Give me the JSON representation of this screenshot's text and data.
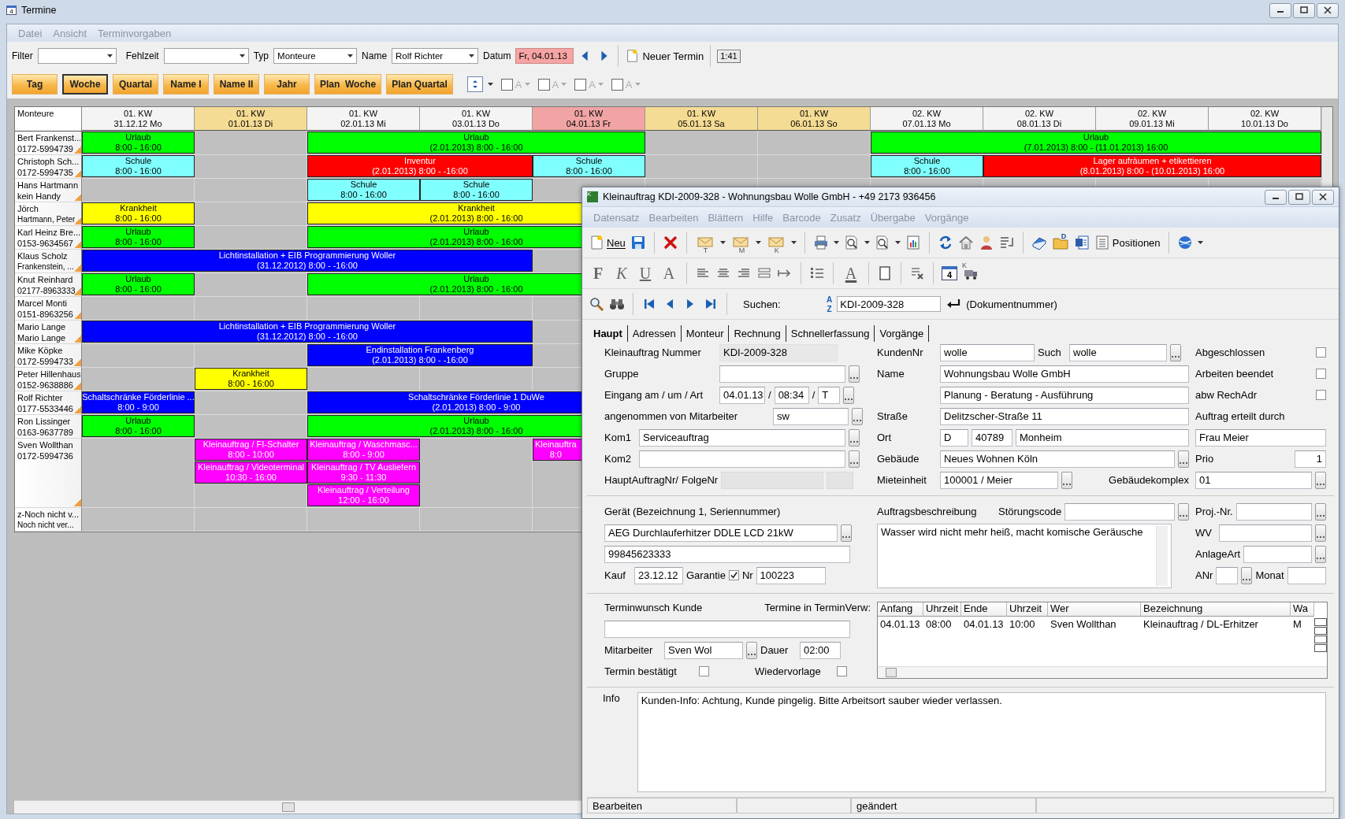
{
  "window": {
    "title": "Termine",
    "icon_label": "4"
  },
  "menu": [
    "Datei",
    "Ansicht",
    "Terminvorgaben"
  ],
  "filter_bar": {
    "fields": [
      {
        "label": "Filter"
      },
      {
        "label": "Fehlzeit"
      },
      {
        "label": "Typ",
        "value": "Monteure"
      },
      {
        "label": "Name",
        "value": "Rolf Richter"
      }
    ],
    "date_label": "Datum",
    "date_value": "Fr, 04.01.13",
    "new_button": "Neuer Termin",
    "clock": "1:41"
  },
  "view_buttons": [
    {
      "label": "Tag",
      "selected": false
    },
    {
      "label": "Woche",
      "selected": true
    },
    {
      "label": "Quartal",
      "selected": false
    },
    {
      "label": "Name I",
      "selected": false
    },
    {
      "label": "Name II",
      "selected": false
    },
    {
      "label": "Jahr",
      "selected": false
    },
    {
      "label": "Plan  Woche",
      "selected": false
    },
    {
      "label": "Plan Quartal",
      "selected": false
    }
  ],
  "color_filters": [
    {
      "label": "A",
      "checked": false
    },
    {
      "label": "A",
      "checked": false
    },
    {
      "label": "A",
      "checked": false
    },
    {
      "label": "A",
      "checked": false
    }
  ],
  "planner": {
    "corner": "Monteure",
    "columns": [
      {
        "week": "01. KW",
        "date": "31.12.12 Mo",
        "color": "#f4f4f4"
      },
      {
        "week": "01. KW",
        "date": "01.01.13 Di",
        "color": "#f5dc94"
      },
      {
        "week": "01. KW",
        "date": "02.01.13 Mi",
        "color": "#f4f4f4"
      },
      {
        "week": "01. KW",
        "date": "03.01.13 Do",
        "color": "#f4f4f4"
      },
      {
        "week": "01. KW",
        "date": "04.01.13 Fr",
        "color": "#f0a4a4"
      },
      {
        "week": "01. KW",
        "date": "05.01.13 Sa",
        "color": "#f5dc94"
      },
      {
        "week": "01. KW",
        "date": "06.01.13 So",
        "color": "#f5dc94"
      },
      {
        "week": "02. KW",
        "date": "07.01.13 Mo",
        "color": "#f4f4f4"
      },
      {
        "week": "02. KW",
        "date": "08.01.13 Di",
        "color": "#f4f4f4"
      },
      {
        "week": "02. KW",
        "date": "09.01.13 Mi",
        "color": "#f4f4f4"
      },
      {
        "week": "02. KW",
        "date": "10.01.13 Do",
        "color": "#f4f4f4"
      }
    ],
    "rows": [
      {
        "name": "Bert Frankenst...",
        "phone": "0172-5994739",
        "marked": true,
        "lanes": [
          [
            {
              "kind": "event",
              "title": "Urlaub",
              "time": "8:00 - 16:00",
              "color": "#00ff00",
              "cut": false
            },
            {
              "kind": "gap"
            },
            {
              "kind": "event",
              "title": "Urlaub",
              "time": "(2.01.2013) 8:00 - 16:00",
              "color": "#00ff00",
              "cut": false
            },
            {
              "kind": "more"
            },
            {
              "kind": "more"
            },
            {
              "kind": "gap"
            },
            {
              "kind": "gap"
            },
            {
              "kind": "event",
              "title": "Urlaub",
              "time": "(7.01.2013) 8:00 - (11.01.2013) 16:00",
              "color": "#00ff00",
              "cut": false
            },
            {
              "kind": "more"
            },
            {
              "kind": "more"
            },
            {
              "kind": "more"
            }
          ]
        ]
      },
      {
        "name": "Christoph Sch...",
        "phone": "0172-5994735",
        "marked": true,
        "lanes": [
          [
            {
              "kind": "event",
              "title": "Schule",
              "time": "8:00 - 16:00",
              "color": "#80ffff",
              "cut": false
            },
            {
              "kind": "gap"
            },
            {
              "kind": "event",
              "title": "Inventur",
              "time": "(2.01.2013) 8:00 - -16:00",
              "color": "#ff0000",
              "cut": false
            },
            {
              "kind": "more"
            },
            {
              "kind": "event",
              "title": "Schule",
              "time": "8:00 - 16:00",
              "color": "#80ffff",
              "cut": false
            },
            {
              "kind": "gap"
            },
            {
              "kind": "gap"
            },
            {
              "kind": "event",
              "title": "Schule",
              "time": "8:00 - 16:00",
              "color": "#80ffff",
              "cut": false
            },
            {
              "kind": "event",
              "title": "Lager aufräumen + etikettieren",
              "time": "(8.01.2013) 8:00 - (10.01.2013) 16:00",
              "color": "#ff0000",
              "cut": false
            },
            {
              "kind": "more"
            },
            {
              "kind": "more"
            }
          ]
        ]
      },
      {
        "name": "Hans Hartmann",
        "phone": "kein Handy",
        "marked": true,
        "lanes": [
          [
            {
              "kind": "gap"
            },
            {
              "kind": "gap"
            },
            {
              "kind": "event",
              "title": "Schule",
              "time": "8:00 - 16:00",
              "color": "#80ffff",
              "cut": false
            },
            {
              "kind": "event",
              "title": "Schule",
              "time": "8:00 - 16:00",
              "color": "#80ffff",
              "cut": false
            }
          ]
        ]
      },
      {
        "name": "Jörch",
        "phone": "Hartmann, Peter",
        "marked": true,
        "lanes": [
          [
            {
              "kind": "event",
              "title": "Krankheit",
              "time": "8:00 - 16:00",
              "color": "#ffff00",
              "cut": false
            },
            {
              "kind": "gap"
            },
            {
              "kind": "event",
              "title": "Krankheit",
              "time": "(2.01.2013) 8:00 - 16:00",
              "color": "#ffff00",
              "cut": false
            },
            {
              "kind": "more"
            },
            {
              "kind": "more"
            }
          ]
        ]
      },
      {
        "name": "Karl Heinz Bre...",
        "phone": "0153-9634567",
        "marked": true,
        "lanes": [
          [
            {
              "kind": "event",
              "title": "Urlaub",
              "time": "8:00 - 16:00",
              "color": "#00ff00",
              "cut": false
            },
            {
              "kind": "gap"
            },
            {
              "kind": "event",
              "title": "Urlaub",
              "time": "(2.01.2013) 8:00 - 16:00",
              "color": "#00ff00",
              "cut": false
            },
            {
              "kind": "more"
            },
            {
              "kind": "more"
            }
          ]
        ]
      },
      {
        "name": "Klaus Scholz",
        "phone": "Frankenstein, ...",
        "marked": true,
        "lanes": [
          [
            {
              "kind": "event",
              "title": "Lichtinstallation + EIB Programmierung Woller",
              "time": "(31.12.2012) 8:00 - -16:00",
              "color": "#0000ff",
              "cut": false
            },
            {
              "kind": "more"
            },
            {
              "kind": "more"
            },
            {
              "kind": "more"
            }
          ]
        ]
      },
      {
        "name": "Knut Reinhard",
        "phone": "02177-8963333",
        "marked": true,
        "lanes": [
          [
            {
              "kind": "event",
              "title": "Urlaub",
              "time": "8:00 - 16:00",
              "color": "#00ff00",
              "cut": false
            },
            {
              "kind": "gap"
            },
            {
              "kind": "event",
              "title": "Urlaub",
              "time": "(2.01.2013) 8:00 - 16:00",
              "color": "#00ff00",
              "cut": false
            },
            {
              "kind": "more"
            },
            {
              "kind": "more"
            }
          ]
        ]
      },
      {
        "name": "Marcel Monti",
        "phone": "0151-8963256",
        "marked": true
      },
      {
        "name": "Mario Lange",
        "phone": "Mario Lange",
        "marked": true,
        "lanes": [
          [
            {
              "kind": "event",
              "title": "Lichtinstallation + EIB Programmierung Woller",
              "time": "(31.12.2012) 8:00 - -16:00",
              "color": "#0000ff",
              "cut": false
            },
            {
              "kind": "more"
            },
            {
              "kind": "more"
            },
            {
              "kind": "more"
            }
          ]
        ]
      },
      {
        "name": "Mike Köpke",
        "phone": "0172-5994733",
        "marked": true,
        "lanes": [
          [
            {
              "kind": "gap"
            },
            {
              "kind": "gap"
            },
            {
              "kind": "event",
              "title": "Endinstallation Frankenberg",
              "time": "(2.01.2013) 8:00 - -16:00",
              "color": "#0000ff",
              "cut": false
            },
            {
              "kind": "more"
            }
          ]
        ]
      },
      {
        "name": "Peter Hillenhaus",
        "phone": "0152-9638886",
        "marked": true,
        "lanes": [
          [
            {
              "kind": "gap"
            },
            {
              "kind": "event",
              "title": "Krankheit",
              "time": "8:00 - 16:00",
              "color": "#ffff00",
              "cut": false
            }
          ]
        ]
      },
      {
        "name": "Rolf Richter",
        "phone": "0177-5533446",
        "marked": true,
        "lanes": [
          [
            {
              "kind": "event",
              "title": "Schaltschränke Förderlinie ...",
              "time": "8:00 - 9:00",
              "color": "#0000ff",
              "cut": false
            },
            {
              "kind": "gap"
            },
            {
              "kind": "event",
              "title": "Schaltschränke Förderlinie 1 DuWe",
              "time": "(2.01.2013) 8:00 - 9:00",
              "color": "#0000ff",
              "cut": false
            },
            {
              "kind": "more"
            },
            {
              "kind": "more"
            }
          ]
        ]
      },
      {
        "name": "Ron Lissinger",
        "phone": "0163-9637789",
        "marked": false,
        "lanes": [
          [
            {
              "kind": "event",
              "title": "Urlaub",
              "time": "8:00 - 16:00",
              "color": "#00ff00",
              "cut": false
            },
            {
              "kind": "gap"
            },
            {
              "kind": "event",
              "title": "Urlaub",
              "time": "(2.01.2013) 8:00 - 16:00",
              "color": "#00ff00",
              "cut": false
            },
            {
              "kind": "more"
            },
            {
              "kind": "more"
            }
          ]
        ]
      },
      {
        "name": "Sven Wollthan",
        "phone": "0172-5994736",
        "marked": true,
        "lanes": [
          [
            {
              "kind": "gap"
            },
            {
              "kind": "event",
              "title": "Kleinauftrag / FI-Schalter",
              "time": "8:00 - 10:00",
              "color": "#ff00ff",
              "cut": false
            },
            {
              "kind": "event",
              "title": "Kleinauftrag / Waschmasc...",
              "time": "8:00 - 9:00",
              "color": "#ff00ff",
              "cut": false
            },
            {
              "kind": "gap"
            },
            {
              "kind": "event",
              "title": "Kleinauftra",
              "time": "8:0",
              "color": "#ff00ff",
              "cut": true
            }
          ],
          [
            {
              "kind": "gap"
            },
            {
              "kind": "event",
              "title": "Kleinauftrag / Videoterminal",
              "time": "10:30 - 16:00",
              "color": "#ff00ff",
              "cut": false
            },
            {
              "kind": "event",
              "title": "Kleinauftrag / TV Ausliefern",
              "time": "9:30 - 11:30",
              "color": "#ff00ff",
              "cut": false
            }
          ],
          [
            {
              "kind": "gap"
            },
            {
              "kind": "gap"
            },
            {
              "kind": "event",
              "title": "Kleinauftrag / Verteilung",
              "time": "12:00 - 16:00",
              "color": "#ff00ff",
              "cut": false
            }
          ]
        ]
      },
      {
        "name": "z-Noch nicht v...",
        "phone": "Noch nicht ver...",
        "marked": false
      }
    ]
  },
  "dialog": {
    "title": "Kleinauftrag KDI-2009-328 - Wohnungsbau Wolle GmbH - +49 2173 936456",
    "icon_label": "K",
    "menu": [
      "Datensatz",
      "Bearbeiten",
      "Blättern",
      "Hilfe",
      "Barcode",
      "Zusatz",
      "Übergabe",
      "Vorgänge"
    ],
    "toolbar": {
      "new_label": "Neu",
      "mail_letters": [
        "T",
        "M",
        "K"
      ],
      "folder_letter": "D",
      "positions_label": "Positionen"
    },
    "format_bar": {
      "styles": [
        "F",
        "K",
        "U",
        "A"
      ],
      "text_color_letter": "A",
      "calendar_day": "4",
      "transfer_letter": "K"
    },
    "search_bar": {
      "label": "Suchen:",
      "sort_letters": [
        "A",
        "Z"
      ],
      "value": "KDI-2009-328",
      "hint": "(Dokumentnummer)"
    },
    "tabs": [
      {
        "label": "Haupt",
        "selected": true
      },
      {
        "label": "Adressen",
        "selected": false
      },
      {
        "label": "Monteur",
        "selected": false
      },
      {
        "label": "Rechnung",
        "selected": false
      },
      {
        "label": "Schnellerfassung",
        "selected": false
      },
      {
        "label": "Vorgänge",
        "selected": false
      }
    ],
    "form": {
      "order": {
        "label": "Kleinauftrag Nummer",
        "value": "KDI-2009-328"
      },
      "group": {
        "label": "Gruppe"
      },
      "received": {
        "label": "Eingang am / um / Art",
        "date": "04.01.13",
        "sep1": "/",
        "time": "08:34",
        "sep2": "/",
        "type": "T"
      },
      "accepted_by": {
        "label": "angenommen von Mitarbeiter",
        "value": "sw"
      },
      "kom1": {
        "label": "Kom1",
        "value": "Serviceauftrag"
      },
      "kom2": {
        "label": "Kom2"
      },
      "main_order": {
        "label": "HauptAuftragNr/",
        "label_2": "FolgeNr"
      },
      "customer_no": {
        "label": "KundenNr",
        "value": "wolle"
      },
      "match": {
        "label": "Such",
        "value": "wolle"
      },
      "name": {
        "label": "Name",
        "value": "Wohnungsbau Wolle GmbH",
        "value_2": "Planung - Beratung - Ausführung"
      },
      "street": {
        "label": "Straße",
        "value": "Delitzscher-Straße 11"
      },
      "city": {
        "label": "Ort",
        "country": "D",
        "zip": "40789",
        "city": "Monheim"
      },
      "building": {
        "label": "Gebäude",
        "value": "Neues Wohnen Köln"
      },
      "unit": {
        "label": "Mieteinheit",
        "value": "100001 / Meier"
      },
      "complex": {
        "label": "Gebäudekomplex",
        "value": "01"
      },
      "flags": [
        {
          "label": "Abgeschlossen",
          "checked": false
        },
        {
          "label": "Arbeiten beendet",
          "checked": false
        },
        {
          "label": "abw RechAdr",
          "checked": false
        }
      ],
      "ordered_by": {
        "label": "Auftrag erteilt durch",
        "value": "Frau Meier"
      },
      "priority": {
        "label": "Prio",
        "value": "1"
      },
      "device": {
        "label": "Gerät (Bezeichnung 1, Seriennummer)",
        "value": "AEG Durchlauferhitzer DDLE LCD 21kW",
        "serial": "99845623333"
      },
      "purchase": {
        "label": "Kauf",
        "value": "23.12.12"
      },
      "warranty": {
        "label": "Garantie",
        "checked": true
      },
      "warranty_no": {
        "label": "Nr",
        "value": "100223"
      },
      "description": {
        "label": "Auftragsbeschreibung",
        "value": "Wasser wird nicht mehr heiß, macht komische Geräusche"
      },
      "fault_code": {
        "label": "Störungscode"
      },
      "project": {
        "label": "Proj.-Nr."
      },
      "wv": {
        "label": "WV"
      },
      "system_type": {
        "label": "AnlageArt"
      },
      "anr": {
        "label": "ANr"
      },
      "month": {
        "label": "Monat"
      },
      "appointment_wish": {
        "label": "Terminwunsch Kunde"
      },
      "appointments_label": "Termine in TerminVerw:",
      "employee": {
        "label": "Mitarbeiter",
        "value": "Sven Wol"
      },
      "duration": {
        "label": "Dauer",
        "value": "02:00"
      },
      "confirmed": {
        "label": "Termin bestätigt",
        "checked": false
      },
      "resubmission": {
        "label": "Wiedervorlage",
        "checked": false
      },
      "appointments": {
        "columns": [
          "Anfang",
          "Uhrzeit",
          "Ende",
          "Uhrzeit",
          "Wer",
          "Bezeichnung",
          "Wa"
        ],
        "rows": [
          [
            "04.01.13",
            "08:00",
            "04.01.13",
            "10:00",
            "Sven Wollthan",
            "Kleinauftrag / DL-Erhitzer",
            "M"
          ]
        ]
      },
      "info": {
        "label": "Info",
        "value": "Kunden-Info: Achtung, Kunde pingelig. Bitte Arbeitsort sauber wieder verlassen."
      }
    },
    "status_bar": {
      "mode": "Bearbeiten",
      "state": "geändert"
    }
  }
}
